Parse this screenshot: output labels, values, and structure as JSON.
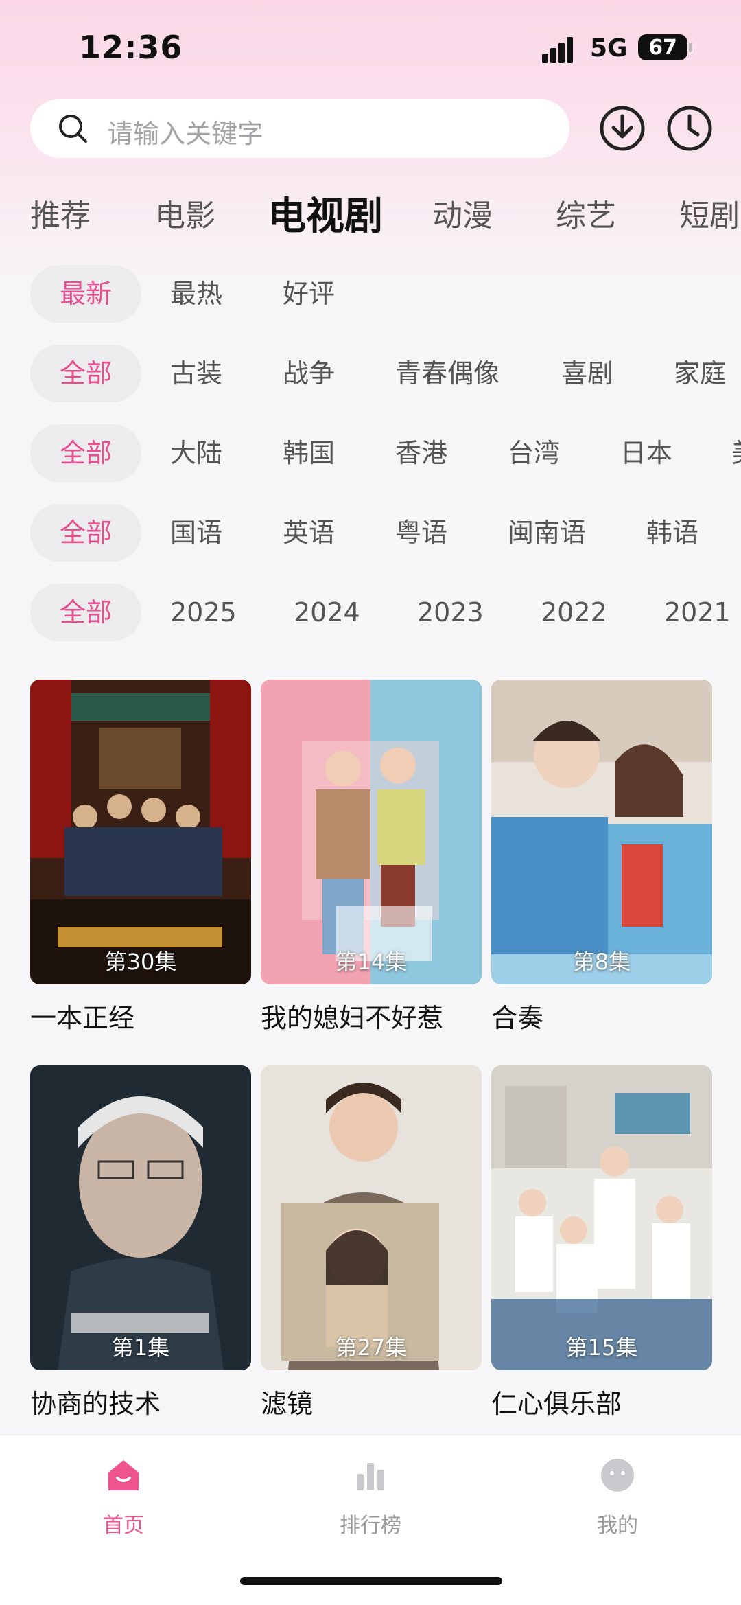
{
  "status_bar": {
    "time": "12:36",
    "network": "5G",
    "battery": "67"
  },
  "search": {
    "placeholder": "请输入关键字"
  },
  "category_tabs": [
    {
      "label": "推荐"
    },
    {
      "label": "电影"
    },
    {
      "label": "电视剧",
      "active": true
    },
    {
      "label": "动漫"
    },
    {
      "label": "综艺"
    },
    {
      "label": "短剧"
    }
  ],
  "filters": {
    "sort": [
      "最新",
      "最热",
      "好评"
    ],
    "genre": [
      "全部",
      "古装",
      "战争",
      "青春偶像",
      "喜剧",
      "家庭"
    ],
    "region": [
      "全部",
      "大陆",
      "韩国",
      "香港",
      "台湾",
      "日本",
      "美"
    ],
    "language": [
      "全部",
      "国语",
      "英语",
      "粤语",
      "闽南语",
      "韩语"
    ],
    "year": [
      "全部",
      "2025",
      "2024",
      "2023",
      "2022",
      "2021"
    ]
  },
  "shows": [
    {
      "title": "一本正经",
      "episode": "第30集"
    },
    {
      "title": "我的媳妇不好惹",
      "episode": "第14集"
    },
    {
      "title": "合奏",
      "episode": "第8集"
    },
    {
      "title": "协商的技术",
      "episode": "第1集"
    },
    {
      "title": "滤镜",
      "episode": "第27集"
    },
    {
      "title": "仁心俱乐部",
      "episode": "第15集"
    }
  ],
  "bottom_nav": [
    {
      "label": "首页",
      "active": true
    },
    {
      "label": "排行榜"
    },
    {
      "label": "我的"
    }
  ],
  "colors": {
    "accent": "#f0548f",
    "selected_text": "#e6508f"
  },
  "icons": [
    "search-icon",
    "download-icon",
    "history-icon",
    "home-icon",
    "ranking-icon",
    "profile-icon"
  ]
}
